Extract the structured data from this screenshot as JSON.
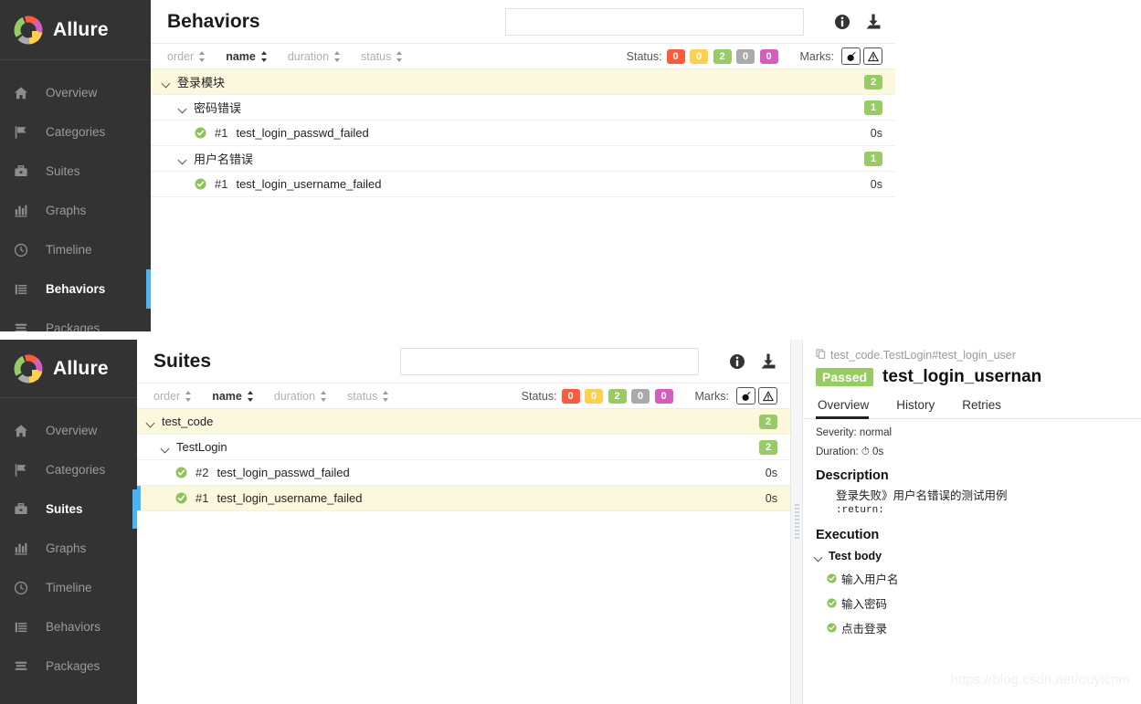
{
  "brand": {
    "name": "Allure",
    "logo_colors": [
      "#97cc64",
      "#fd5a3e",
      "#d35ebe",
      "#ffd050",
      "#aaaaaa"
    ]
  },
  "sidebar": {
    "items_top": [
      {
        "label": "Overview",
        "icon": "home-icon",
        "active": false
      },
      {
        "label": "Categories",
        "icon": "flag-icon",
        "active": false
      },
      {
        "label": "Suites",
        "icon": "suitcase-icon",
        "active": false
      },
      {
        "label": "Graphs",
        "icon": "bar-chart-icon",
        "active": false
      },
      {
        "label": "Timeline",
        "icon": "clock-icon",
        "active": false
      },
      {
        "label": "Behaviors",
        "icon": "list-icon",
        "active": true
      },
      {
        "label": "Packages",
        "icon": "layers-icon",
        "active": false
      }
    ],
    "items_bottom": [
      {
        "label": "Overview",
        "icon": "home-icon",
        "active": false
      },
      {
        "label": "Categories",
        "icon": "flag-icon",
        "active": false
      },
      {
        "label": "Suites",
        "icon": "suitcase-icon",
        "active": true
      },
      {
        "label": "Graphs",
        "icon": "bar-chart-icon",
        "active": false
      },
      {
        "label": "Timeline",
        "icon": "clock-icon",
        "active": false
      },
      {
        "label": "Behaviors",
        "icon": "list-icon",
        "active": false
      },
      {
        "label": "Packages",
        "icon": "layers-icon",
        "active": false
      }
    ]
  },
  "top_panel": {
    "title": "Behaviors",
    "search": {
      "value": "",
      "placeholder": ""
    },
    "icons": {
      "info": "info-icon",
      "download": "download-icon"
    },
    "sorters": [
      {
        "label": "order",
        "active": false
      },
      {
        "label": "name",
        "active": true
      },
      {
        "label": "duration",
        "active": false
      },
      {
        "label": "status",
        "active": false
      }
    ],
    "status_caption": "Status:",
    "status_chips": [
      {
        "value": "0",
        "color": "#fd5a3e",
        "name": "failed"
      },
      {
        "value": "0",
        "color": "#ffd050",
        "name": "broken"
      },
      {
        "value": "2",
        "color": "#97cc64",
        "name": "passed"
      },
      {
        "value": "0",
        "color": "#aaaaaa",
        "name": "skipped"
      },
      {
        "value": "0",
        "color": "#d35ebe",
        "name": "unknown"
      }
    ],
    "marks_caption": "Marks:",
    "marks": [
      {
        "icon": "bomb-icon"
      },
      {
        "icon": "flaky-warning-icon"
      }
    ],
    "rows": [
      {
        "level": 0,
        "name": "登录模块",
        "order": "",
        "duration": "",
        "badge": "2",
        "selected": false
      },
      {
        "level": 1,
        "name": "密码错误",
        "order": "",
        "duration": "",
        "badge": "1",
        "selected": false
      },
      {
        "level": 2,
        "name": "test_login_passwd_failed",
        "order": "#1",
        "duration": "0s",
        "badge": "",
        "selected": false
      },
      {
        "level": 1,
        "name": "用户名错误",
        "order": "",
        "duration": "",
        "badge": "1",
        "selected": false
      },
      {
        "level": 2,
        "name": "test_login_username_failed",
        "order": "#1",
        "duration": "0s",
        "badge": "",
        "selected": false
      }
    ]
  },
  "bottom_panel": {
    "title": "Suites",
    "search": {
      "value": "",
      "placeholder": ""
    },
    "icons": {
      "info": "info-icon",
      "download": "download-icon"
    },
    "sorters": [
      {
        "label": "order",
        "active": false
      },
      {
        "label": "name",
        "active": true
      },
      {
        "label": "duration",
        "active": false
      },
      {
        "label": "status",
        "active": false
      }
    ],
    "status_caption": "Status:",
    "status_chips": [
      {
        "value": "0",
        "color": "#fd5a3e",
        "name": "failed"
      },
      {
        "value": "0",
        "color": "#ffd050",
        "name": "broken"
      },
      {
        "value": "2",
        "color": "#97cc64",
        "name": "passed"
      },
      {
        "value": "0",
        "color": "#aaaaaa",
        "name": "skipped"
      },
      {
        "value": "0",
        "color": "#d35ebe",
        "name": "unknown"
      }
    ],
    "marks_caption": "Marks:",
    "marks": [
      {
        "icon": "bomb-icon"
      },
      {
        "icon": "flaky-warning-icon"
      }
    ],
    "rows": [
      {
        "level": 0,
        "name": "test_code",
        "order": "",
        "duration": "",
        "badge": "2",
        "selected": false
      },
      {
        "level": 1,
        "name": "TestLogin",
        "order": "",
        "duration": "",
        "badge": "2",
        "selected": false
      },
      {
        "level": 2,
        "name": "test_login_passwd_failed",
        "order": "#2",
        "duration": "0s",
        "badge": "",
        "selected": false
      },
      {
        "level": 2,
        "name": "test_login_username_failed",
        "order": "#1",
        "duration": "0s",
        "badge": "",
        "selected": true
      }
    ],
    "detail": {
      "breadcrumb": "test_code.TestLogin#test_login_user",
      "status_badge": "Passed",
      "title": "test_login_usernan",
      "tabs": [
        {
          "label": "Overview",
          "active": true
        },
        {
          "label": "History",
          "active": false
        },
        {
          "label": "Retries",
          "active": false
        }
      ],
      "severity": "Severity: normal",
      "duration": "Duration: 0s",
      "description_header": "Description",
      "description_text": "登录失败》用户名错误的测试用例",
      "description_mono": ":return:",
      "execution_header": "Execution",
      "test_body_label": "Test body",
      "steps": [
        {
          "label": "输入用户名",
          "status": "passed"
        },
        {
          "label": "输入密码",
          "status": "passed"
        },
        {
          "label": "点击登录",
          "status": "passed"
        }
      ]
    }
  },
  "watermark": "https://blog.csdn.net/ouyicnm"
}
